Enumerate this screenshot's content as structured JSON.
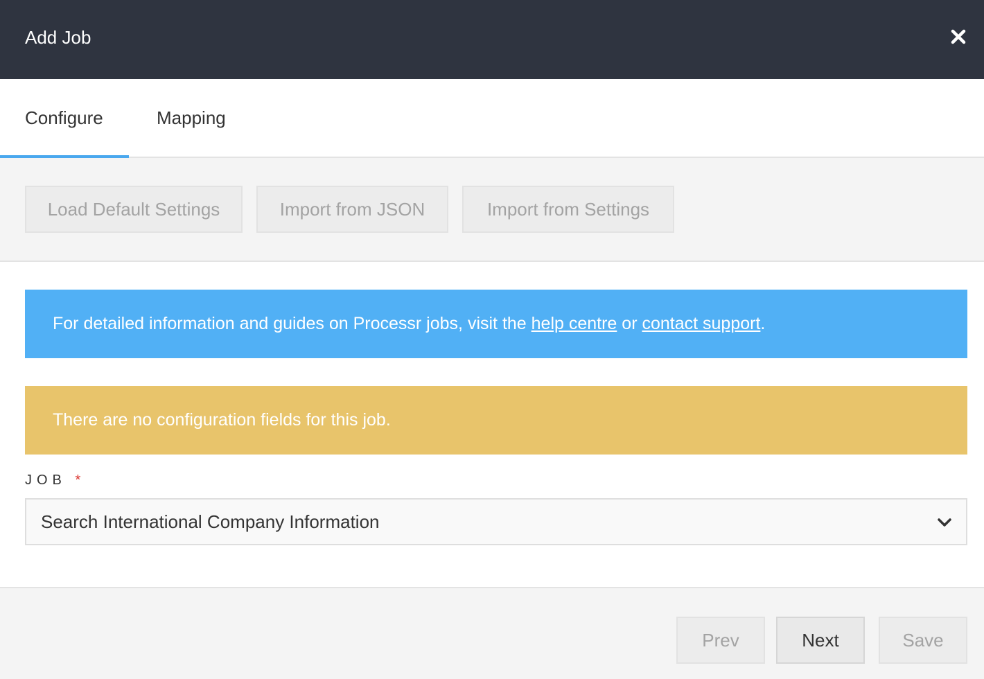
{
  "header": {
    "title": "Add Job",
    "close_icon": "close-icon"
  },
  "tabs": [
    {
      "label": "Configure",
      "active": true
    },
    {
      "label": "Mapping",
      "active": false
    }
  ],
  "toolbar": {
    "load_default": "Load Default Settings",
    "import_json": "Import from JSON",
    "import_settings": "Import from Settings"
  },
  "info": {
    "text_before": "For detailed information and guides on Processr jobs, visit the ",
    "link1": "help centre",
    "text_middle": " or ",
    "link2": "contact support",
    "text_after": ".",
    "color": "#51b0f5"
  },
  "warning": {
    "text": "There are no configuration fields for this job.",
    "color": "#e8c46b"
  },
  "job_field": {
    "label": "JOB",
    "required_mark": "*",
    "value": "Search International Company Information",
    "icon": "chevron-down-icon"
  },
  "footer": {
    "prev": "Prev",
    "next": "Next",
    "save": "Save"
  },
  "colors": {
    "header_bg": "#2f3440",
    "accent": "#4aa8ee",
    "required": "#d9302b"
  }
}
